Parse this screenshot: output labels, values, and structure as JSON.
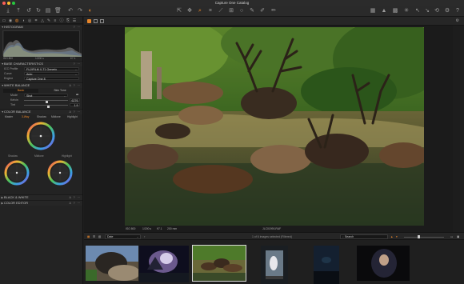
{
  "window": {
    "title": "Capture One Catalog",
    "traffic_colors": [
      "#fc5f57",
      "#fdbc2e",
      "#28c840"
    ]
  },
  "toolbar": {
    "left_icons": [
      "import-icon",
      "export-icon",
      "rotate-left-icon",
      "rotate-right-icon",
      "copy-icon",
      "trash-icon",
      "undo-icon",
      "redo-icon",
      "capture-pilot-icon"
    ],
    "center_icons": [
      "cursor-tool-icon",
      "pan-tool-icon",
      "zoom-tool-icon",
      "crop-tool-icon",
      "straighten-tool-icon",
      "keystone-tool-icon",
      "spot-tool-icon",
      "picker-tool-icon",
      "brush-tool-icon"
    ],
    "right_icons": [
      "grid-view-icon",
      "exposure-warning-icon",
      "proof-icon",
      "view-icon",
      "copy-adjustments-icon",
      "apply-adjustments-icon",
      "reset-icon",
      "settings-icon",
      "help-icon"
    ]
  },
  "left_panel": {
    "histogram": {
      "title": "HISTOGRAM",
      "iso": "ISO 800",
      "shutter": "1/200 s",
      "aperture": "f/7.1"
    },
    "base_characteristics": {
      "title": "BASE CHARACTERISTICS",
      "rows": [
        {
          "label": "ICC Profile",
          "value": "FUJIFILM X-T1 Generic"
        },
        {
          "label": "Curve",
          "value": "Auto"
        },
        {
          "label": "Engine",
          "value": "Capture One 8"
        }
      ]
    },
    "white_balance": {
      "title": "WHITE BALANCE",
      "tabs": [
        "Basic",
        "Skin Tone"
      ],
      "mode_label": "Mode",
      "mode_value": "Shot",
      "sliders": [
        {
          "label": "Kelvin",
          "value": "6276",
          "pct": 0.52
        },
        {
          "label": "Tint",
          "value": "1.9",
          "pct": 0.55
        }
      ]
    },
    "color_balance": {
      "title": "COLOR BALANCE",
      "tabs": [
        "Master",
        "3-Way",
        "Shadow",
        "Midtone",
        "Highlight"
      ],
      "active_tab": "3-Way",
      "wheel_labels": [
        "Shadow",
        "Midtone",
        "Highlight"
      ]
    },
    "collapsed_sections": [
      "BLACK & WHITE",
      "COLOR EDITOR"
    ]
  },
  "viewer": {
    "caption_left": "ISO 800",
    "caption_shutter": "1/200 s",
    "caption_aperture": "f/7.1",
    "caption_focal": "200 mm",
    "filename": "JLC01990.RAF"
  },
  "browser": {
    "sort_label": "Date",
    "count_text": "1 of 6 images selected (Filtered)",
    "search_placeholder": "Search"
  },
  "thumbnails": [
    {
      "name": "thumbnail-sea-lion"
    },
    {
      "name": "thumbnail-night-tree"
    },
    {
      "name": "thumbnail-elk-herd",
      "selected": true
    },
    {
      "name": "thumbnail-portrait-window"
    },
    {
      "name": "thumbnail-dark-landscape"
    },
    {
      "name": "thumbnail-dark-portrait"
    }
  ]
}
